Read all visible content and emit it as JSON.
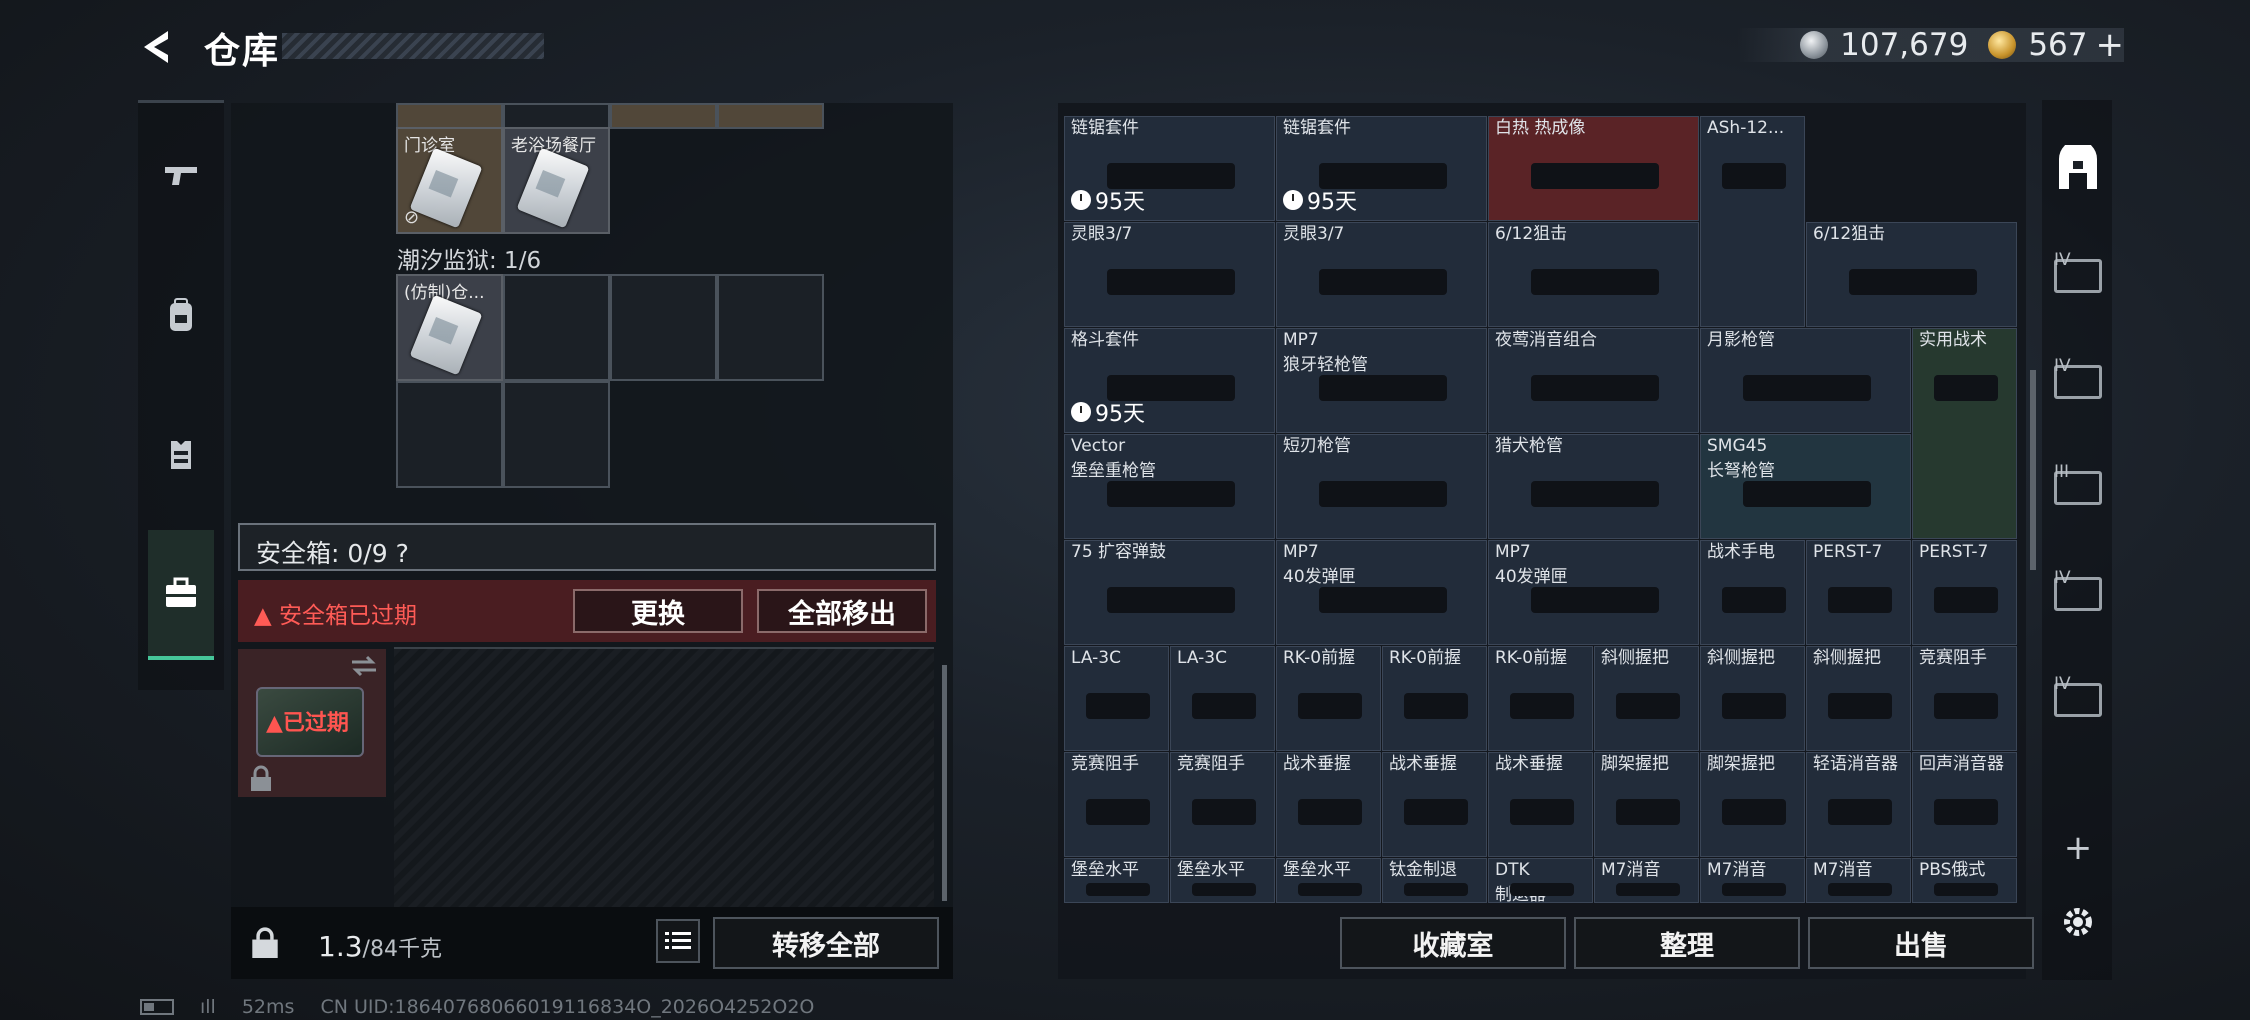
{
  "header": {
    "title": "仓库"
  },
  "currency": {
    "silver": "107,679",
    "gold": "567",
    "add": "+"
  },
  "left_nav": [
    "weapon-tab",
    "backpack-tab",
    "vest-tab",
    "secure-case-tab"
  ],
  "stash": {
    "cards": [
      {
        "name": "门诊室"
      },
      {
        "name": "老浴场餐厅"
      },
      {
        "name": "(仿制)仓..."
      }
    ],
    "section_label": "潮汐监狱: 1/6"
  },
  "safe_box": {
    "label": "安全箱: 0/9",
    "help": "?",
    "alert": "安全箱已过期",
    "replace_btn": "更换",
    "moveall_btn": "全部移出",
    "expired": "已过期"
  },
  "bottom_left": {
    "weight_value": "1.3",
    "weight_unit": "/84千克",
    "transfer_btn": "转移全部"
  },
  "inventory": {
    "rows": [
      [
        {
          "n": "链锯套件",
          "d": "95天"
        },
        {
          "n": "链锯套件",
          "d": "95天"
        },
        {
          "n": "白热 热成像",
          "c": "red"
        },
        {
          "n": "ASh-12..."
        }
      ],
      [
        {
          "n": "灵眼3/7"
        },
        {
          "n": "灵眼3/7"
        },
        {
          "n": "6/12狙击"
        },
        {
          "n": "6/12狙击"
        }
      ],
      [
        {
          "n": "格斗套件",
          "d": "95天"
        },
        {
          "n": "MP7",
          "n2": "狼牙轻枪管"
        },
        {
          "n": "夜莺消音组合"
        },
        {
          "n": "月影枪管"
        },
        {
          "n": "实用战术",
          "c": "green"
        }
      ],
      [
        {
          "n": "Vector",
          "n2": "堡垒重枪管"
        },
        {
          "n": "短刃枪管"
        },
        {
          "n": "猎犬枪管"
        },
        {
          "n": "SMG45",
          "n2": "长弩枪管",
          "c": "teal"
        }
      ],
      [
        {
          "n": "75 扩容弹鼓"
        },
        {
          "n": "MP7",
          "n2": "40发弹匣"
        },
        {
          "n": "MP7",
          "n2": "40发弹匣"
        },
        {
          "n": "战术手电"
        },
        {
          "n": "PERST-7"
        },
        {
          "n": "PERST-7"
        }
      ],
      [
        {
          "n": "LA-3C"
        },
        {
          "n": "LA-3C"
        },
        {
          "n": "RK-0前握"
        },
        {
          "n": "RK-0前握"
        },
        {
          "n": "RK-0前握"
        },
        {
          "n": "斜侧握把"
        },
        {
          "n": "斜侧握把"
        },
        {
          "n": "斜侧握把"
        },
        {
          "n": "竞赛阻手"
        }
      ],
      [
        {
          "n": "竞赛阻手"
        },
        {
          "n": "竞赛阻手"
        },
        {
          "n": "战术垂握"
        },
        {
          "n": "战术垂握"
        },
        {
          "n": "战术垂握"
        },
        {
          "n": "脚架握把"
        },
        {
          "n": "脚架握把"
        },
        {
          "n": "轻语消音器"
        },
        {
          "n": "回声消音器"
        }
      ],
      [
        {
          "n": "堡垒水平"
        },
        {
          "n": "堡垒水平"
        },
        {
          "n": "堡垒水平"
        },
        {
          "n": "钛金制退"
        },
        {
          "n": "DTK",
          "n2": "制退器"
        },
        {
          "n": "M7消音"
        },
        {
          "n": "M7消音"
        },
        {
          "n": "M7消音"
        },
        {
          "n": "PBS俄式"
        }
      ]
    ],
    "buttons": {
      "collection": "收藏室",
      "organize": "整理",
      "sell": "出售"
    }
  },
  "right_nav": {
    "tiers": [
      "IV",
      "IV",
      "III",
      "IV",
      "IV"
    ],
    "add": "+"
  },
  "status": {
    "ping": "52ms",
    "uid": "CN UID:18640768066019116834O_2026O4252O2O"
  }
}
